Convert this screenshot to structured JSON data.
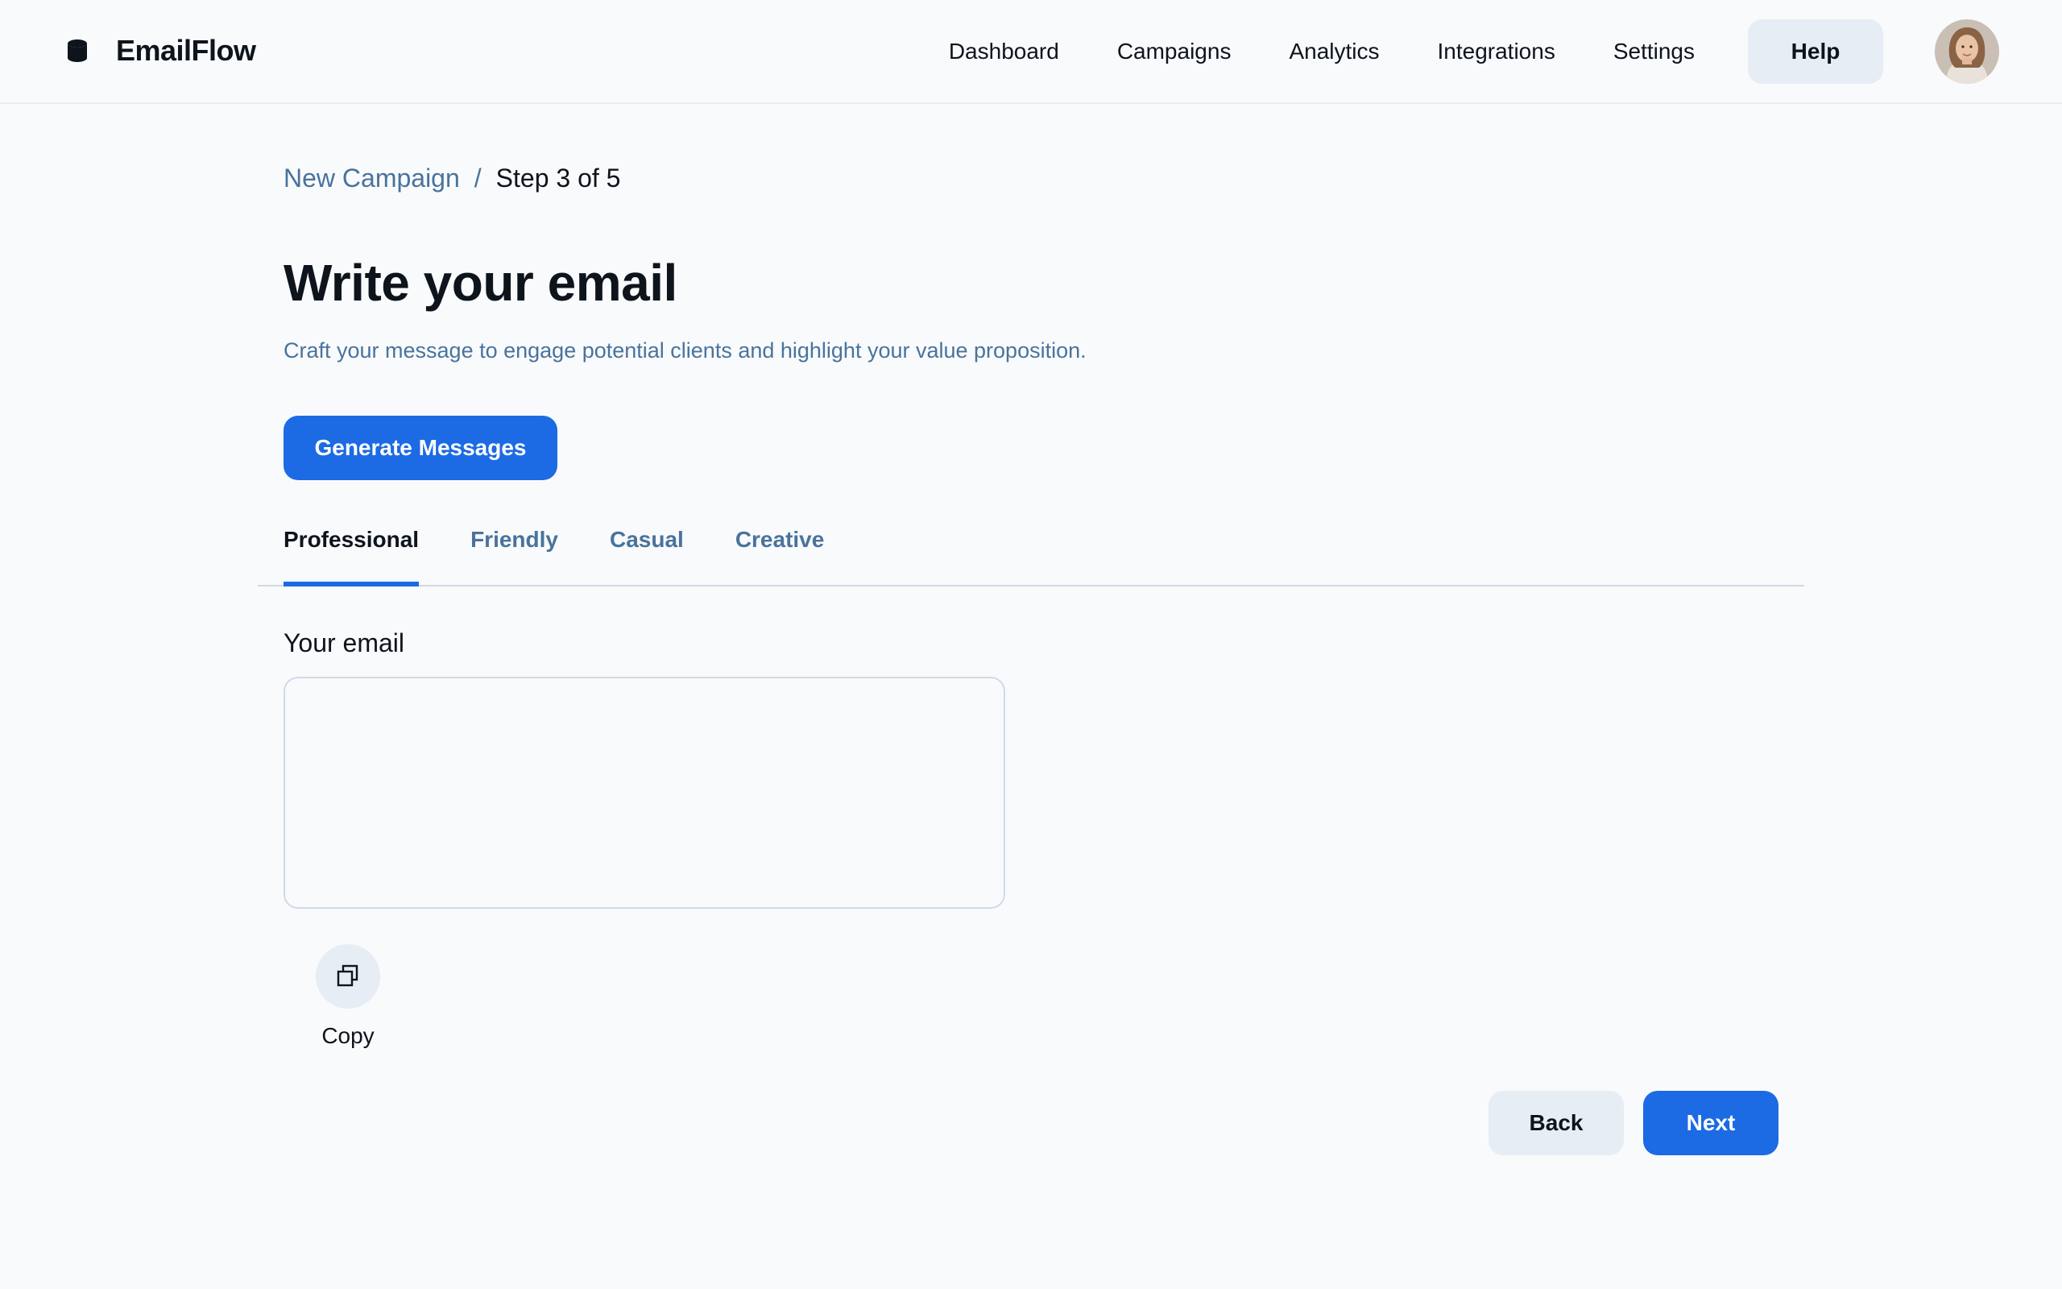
{
  "header": {
    "app_name": "EmailFlow",
    "logo_icon": "database-icon",
    "nav": [
      "Dashboard",
      "Campaigns",
      "Analytics",
      "Integrations",
      "Settings"
    ],
    "help_label": "Help",
    "avatar": "user-avatar"
  },
  "breadcrumb": {
    "parent": "New Campaign",
    "separator": "/",
    "current": "Step 3 of 5"
  },
  "main": {
    "title": "Write your email",
    "subtitle": "Craft your message to engage potential clients and highlight your value proposition.",
    "generate_label": "Generate Messages",
    "tabs": [
      {
        "label": "Professional",
        "active": true
      },
      {
        "label": "Friendly",
        "active": false
      },
      {
        "label": "Casual",
        "active": false
      },
      {
        "label": "Creative",
        "active": false
      }
    ],
    "email_label": "Your email",
    "email_value": "",
    "copy_icon": "copy-icon",
    "copy_label": "Copy"
  },
  "footer": {
    "back_label": "Back",
    "next_label": "Next"
  },
  "colors": {
    "accent": "#1c6ae4",
    "muted_text": "#49739c",
    "surface": "#e7edf4",
    "border": "#cedbe8",
    "background": "#f8fafc",
    "text": "#0d141c"
  }
}
